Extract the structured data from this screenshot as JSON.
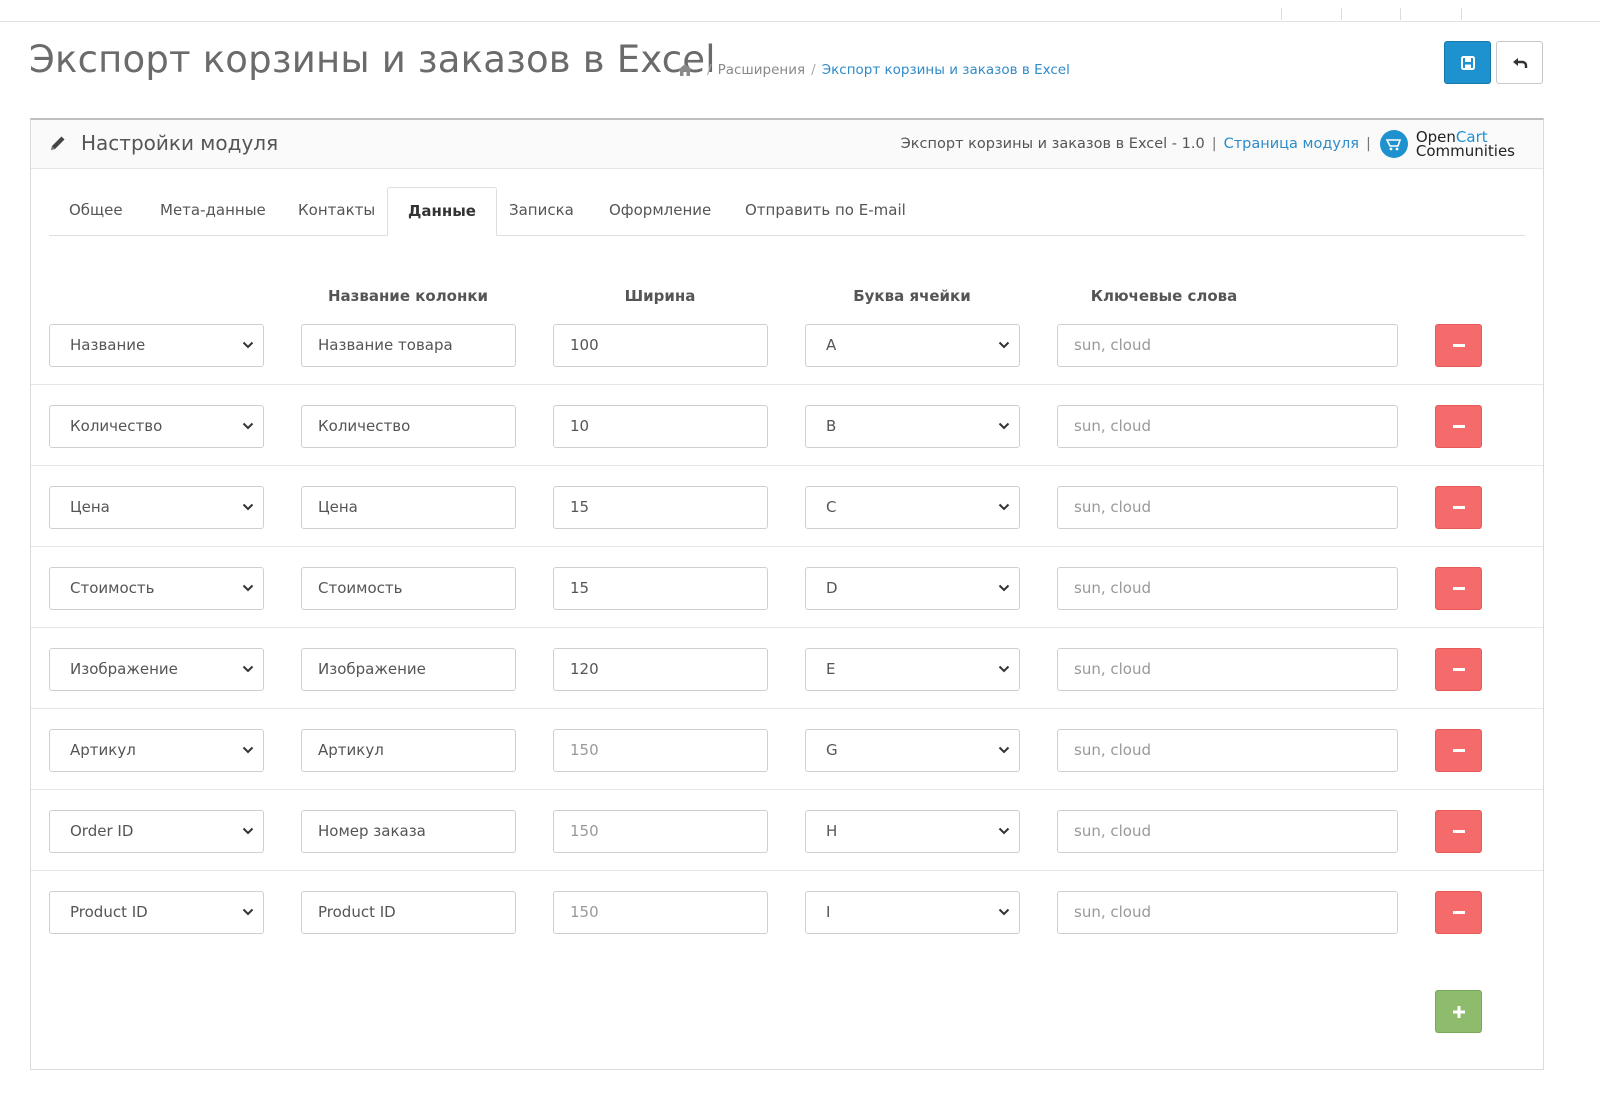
{
  "header": {
    "title": "Экспорт корзины и заказов в Excel",
    "breadcrumb": {
      "extensions": "Расширения",
      "current": "Экспорт корзины и заказов в Excel"
    },
    "save_icon": "save-icon",
    "back_icon": "reply-icon"
  },
  "panel": {
    "title": "Настройки модуля",
    "meta_text": "Экспорт корзины и заказов в Excel - 1.0",
    "meta_link": "Страница модуля",
    "logo_word1": "Open",
    "logo_word1b": "Cart",
    "logo_word2": "Communities"
  },
  "tabs": [
    "Общее",
    "Мета-данные",
    "Контакты",
    "Данные",
    "Записка",
    "Оформление",
    "Отправить по E-mail"
  ],
  "active_tab": "Данные",
  "columns": {
    "name": "Название колонки",
    "width": "Ширина",
    "letter": "Буква ячейки",
    "keywords": "Ключевые слова"
  },
  "rows": [
    {
      "field": "Название",
      "column_name": "Название товара",
      "width": "100",
      "letter": "A",
      "keywords_placeholder": "sun, cloud"
    },
    {
      "field": "Количество",
      "column_name": "Количество",
      "width": "10",
      "letter": "B",
      "keywords_placeholder": "sun, cloud"
    },
    {
      "field": "Цена",
      "column_name": "Цена",
      "width": "15",
      "letter": "C",
      "keywords_placeholder": "sun, cloud"
    },
    {
      "field": "Стоимость",
      "column_name": "Стоимость",
      "width": "15",
      "letter": "D",
      "keywords_placeholder": "sun, cloud"
    },
    {
      "field": "Изображение",
      "column_name": "Изображение",
      "width": "120",
      "letter": "E",
      "keywords_placeholder": "sun, cloud"
    },
    {
      "field": "Артикул",
      "column_name": "Артикул",
      "width_placeholder": "150",
      "letter": "G",
      "keywords_placeholder": "sun, cloud"
    },
    {
      "field": "Order ID",
      "column_name": "Номер заказа",
      "width_placeholder": "150",
      "letter": "H",
      "keywords_placeholder": "sun, cloud"
    },
    {
      "field": "Product ID",
      "column_name": "Product ID",
      "width_placeholder": "150",
      "letter": "I",
      "keywords_placeholder": "sun, cloud"
    }
  ],
  "colors": {
    "primary": "#1e91cf",
    "danger": "#f56b6b",
    "success": "#8fbb6c",
    "link": "#2f8bc9"
  }
}
